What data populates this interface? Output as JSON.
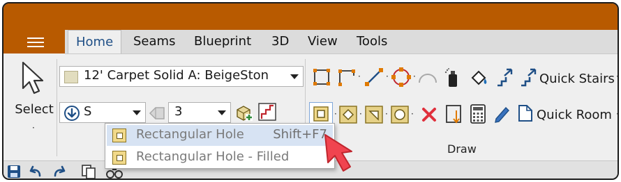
{
  "menu": {
    "icon": "hamburger-icon"
  },
  "tabs": [
    {
      "label": "Home",
      "active": true
    },
    {
      "label": "Seams",
      "active": false
    },
    {
      "label": "Blueprint",
      "active": false
    },
    {
      "label": "3D",
      "active": false
    },
    {
      "label": "View",
      "active": false
    },
    {
      "label": "Tools",
      "active": false
    }
  ],
  "select_tool": {
    "label": "Select",
    "dot": "·",
    "icon": "arrow-cursor-icon"
  },
  "material_combo": {
    "value": "12' Carpet Solid A: BeigeSton",
    "swatch_color": "#e2ddbf"
  },
  "direction_combo": {
    "value": "S",
    "icon": "down-arrow-circle-icon"
  },
  "count_combo": {
    "value": "3"
  },
  "draw_group": {
    "label": "Draw",
    "quick_stairs_label": "Quick Stairs",
    "quick_room_label": "Quick Room",
    "dot": "·"
  },
  "dropdown": {
    "items": [
      {
        "label": "Rectangular Hole",
        "shortcut": "Shift+F7",
        "highlighted": true
      },
      {
        "label": "Rectangular Hole - Filled",
        "shortcut": "",
        "highlighted": false
      }
    ]
  },
  "colors": {
    "title_bar": "#b85a00",
    "accent": "#1f4f86",
    "pointer": "#f0444f",
    "delete": "#e0303c"
  }
}
